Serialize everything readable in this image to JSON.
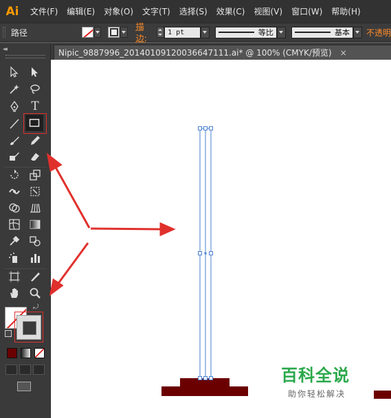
{
  "app": {
    "logo": "Ai",
    "menu": [
      "文件(F)",
      "编辑(E)",
      "对象(O)",
      "文字(T)",
      "选择(S)",
      "效果(C)",
      "视图(V)",
      "窗口(W)",
      "帮助(H)"
    ]
  },
  "control_bar": {
    "selection_label": "路径",
    "stroke_label": "描边:",
    "stroke_weight": "1 pt",
    "profile_label": "等比",
    "brush_label": "基本",
    "opacity_label": "不透明"
  },
  "document": {
    "tab_title": "Nipic_9887996_20140109120036647111.ai*  @  100%  (CMYK/预览)",
    "close_label": "×"
  },
  "toolbar": {
    "collapse": "◂◂",
    "text_tool_glyph": "T"
  },
  "watermark": {
    "title": "百科全说",
    "subtitle": "助你轻松解决"
  },
  "colors": {
    "artwork_fill": "#6b0000",
    "selection": "#4a7fd0",
    "annotation": "#e0302c",
    "brand": "#ff9a00"
  }
}
